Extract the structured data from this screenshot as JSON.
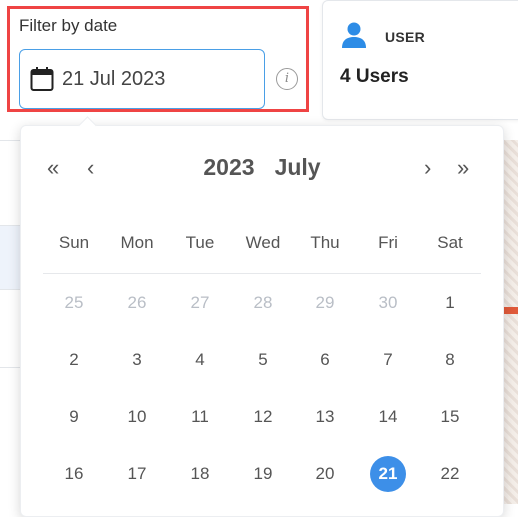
{
  "filter": {
    "label": "Filter by date",
    "date_value": "21 Jul 2023",
    "info_symbol": "i"
  },
  "user_card": {
    "label": "USER",
    "count": "4 Users"
  },
  "calendar": {
    "year": "2023",
    "month": "July",
    "nav": {
      "prev_year": "«",
      "prev_month": "‹",
      "next_month": "›",
      "next_year": "»"
    },
    "weekdays": [
      "Sun",
      "Mon",
      "Tue",
      "Wed",
      "Thu",
      "Fri",
      "Sat"
    ],
    "weeks": [
      [
        {
          "d": "25",
          "muted": true
        },
        {
          "d": "26",
          "muted": true
        },
        {
          "d": "27",
          "muted": true
        },
        {
          "d": "28",
          "muted": true
        },
        {
          "d": "29",
          "muted": true
        },
        {
          "d": "30",
          "muted": true
        },
        {
          "d": "1"
        }
      ],
      [
        {
          "d": "2"
        },
        {
          "d": "3"
        },
        {
          "d": "4"
        },
        {
          "d": "5"
        },
        {
          "d": "6"
        },
        {
          "d": "7"
        },
        {
          "d": "8"
        }
      ],
      [
        {
          "d": "9"
        },
        {
          "d": "10"
        },
        {
          "d": "11"
        },
        {
          "d": "12"
        },
        {
          "d": "13"
        },
        {
          "d": "14"
        },
        {
          "d": "15"
        }
      ],
      [
        {
          "d": "16"
        },
        {
          "d": "17"
        },
        {
          "d": "18"
        },
        {
          "d": "19"
        },
        {
          "d": "20"
        },
        {
          "d": "21",
          "selected": true
        },
        {
          "d": "22"
        }
      ]
    ]
  },
  "colors": {
    "highlight": "#ef4444",
    "accent": "#3d8fe8",
    "input_border": "#4a9fe6",
    "muted_text": "#b9bec6"
  },
  "icons": {
    "user": "user-icon",
    "calendar": "calendar-icon",
    "info": "info-icon"
  }
}
